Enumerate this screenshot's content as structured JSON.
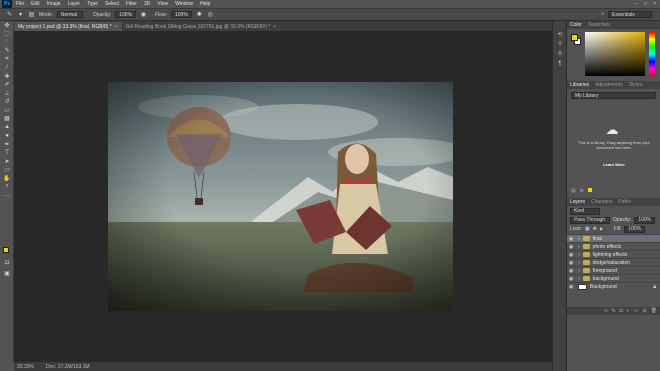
{
  "app": {
    "logo": "Ps"
  },
  "menu": [
    "File",
    "Edit",
    "Image",
    "Layer",
    "Type",
    "Select",
    "Filter",
    "3D",
    "View",
    "Window",
    "Help"
  ],
  "window_controls": [
    "–",
    "□",
    "×"
  ],
  "options": {
    "mode_label": "Mode:",
    "mode_value": "Normal",
    "opacity_label": "Opacity:",
    "opacity_value": "100%",
    "flow_label": "Flow:",
    "flow_value": "100%",
    "workspace": "Essentials"
  },
  "tabs": [
    {
      "label": "My project 1.psd @ 33.3% (final, RGB/8) *",
      "active": true
    },
    {
      "label": "Girl Reading Book Sitting Grass 182761.jpg @ 33.3% (RGB/8#) *",
      "active": false
    }
  ],
  "status": {
    "zoom": "33.33%",
    "doc": "Doc: 17.2M/163.1M"
  },
  "panels": {
    "color_tabs": [
      "Color",
      "Swatches"
    ],
    "library_tabs": [
      "Libraries",
      "Adjustments",
      "Styles"
    ],
    "library_select": "My Library",
    "library_text": "This is a library. Drag anything from your document into here.",
    "library_learn": "Learn More",
    "layer_tabs": [
      "Layers",
      "Channels",
      "Paths"
    ],
    "kind_select": "Kind",
    "blend_select": "Pass Through",
    "opacity_label": "Opacity:",
    "opacity_value": "100%",
    "lock_label": "Lock:",
    "fill_label": "Fill:",
    "fill_value": "100%"
  },
  "layers": [
    {
      "name": "final",
      "type": "folder",
      "selected": true
    },
    {
      "name": "photo effects",
      "type": "folder",
      "selected": false
    },
    {
      "name": "lightning effects",
      "type": "folder",
      "selected": false
    },
    {
      "name": "dodge/saturation",
      "type": "folder",
      "selected": false
    },
    {
      "name": "foreground",
      "type": "folder",
      "selected": false
    },
    {
      "name": "background",
      "type": "folder",
      "selected": false
    },
    {
      "name": "Background",
      "type": "image",
      "selected": false
    }
  ],
  "colors": {
    "foreground": "#f5d600",
    "background": "#ffffff",
    "accent": "#31a8ff"
  }
}
